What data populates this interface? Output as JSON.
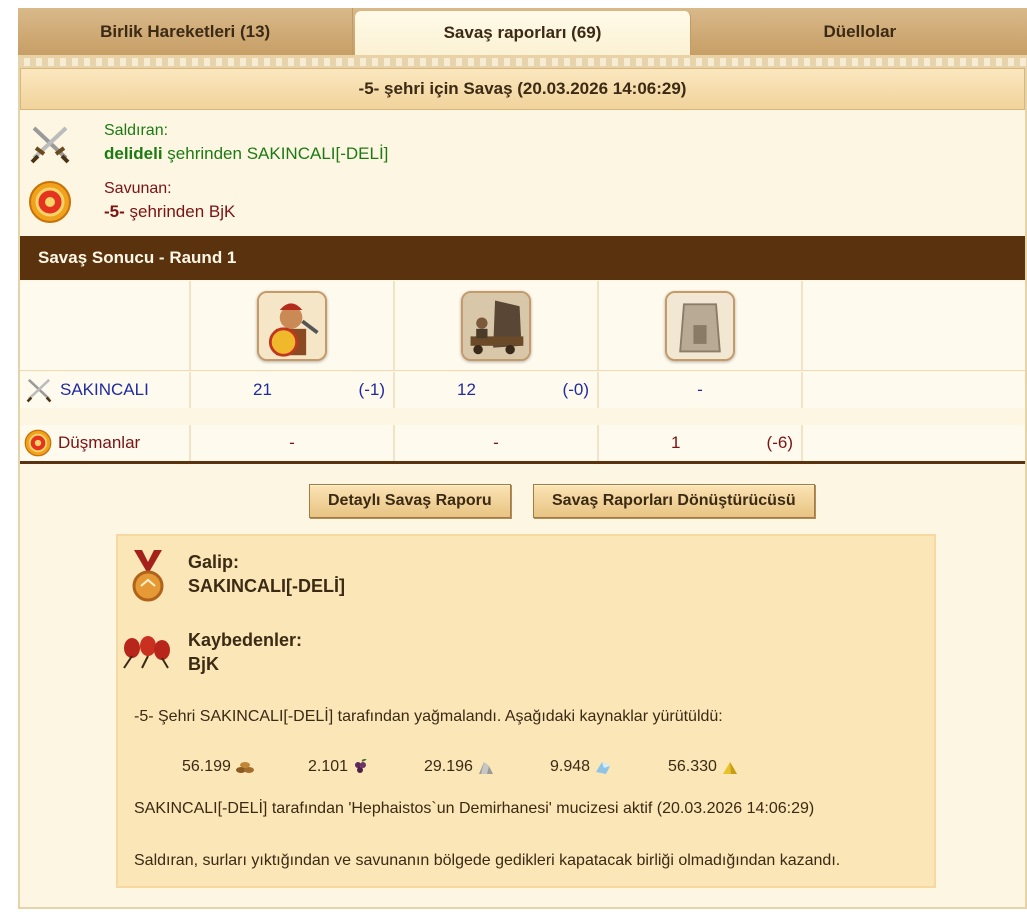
{
  "tabs": [
    {
      "label": "Birlik Hareketleri (13)"
    },
    {
      "label": "Savaş raporları (69)"
    },
    {
      "label": "Düellolar"
    }
  ],
  "report": {
    "title": "-5- şehri için Savaş (20.03.2026 14:06:29)",
    "attacker": {
      "label": "Saldıran:",
      "city": "delideli",
      "rest": " şehrinden SAKINCALI[-DELİ]"
    },
    "defender": {
      "label": "Savunan:",
      "city": "-5-",
      "rest": " şehrinden BjK"
    }
  },
  "result_bar": "Savaş Sonucu - Raund 1",
  "rows": {
    "attacker": {
      "name": "SAKINCALI",
      "u1": "21",
      "u1d": "(-1)",
      "u2": "12",
      "u2d": "(-0)",
      "u3": "-"
    },
    "defender": {
      "name": "Düşmanlar",
      "u1": "-",
      "u2": "-",
      "u3": "1",
      "u3d": "(-6)"
    }
  },
  "buttons": {
    "detailed": "Detaylı Savaş Raporu",
    "converter": "Savaş Raporları Dönüştürücüsü"
  },
  "summary": {
    "winner_label": "Galip:",
    "winner": "SAKINCALI[-DELİ]",
    "loser_label": "Kaybedenler:",
    "loser": "BjK",
    "plunder": "-5- Şehri SAKINCALI[-DELİ] tarafından yağmalandı. Aşağıdaki kaynaklar yürütüldü:",
    "resources": [
      {
        "amount": "56.199",
        "icon": "wood-icon"
      },
      {
        "amount": "2.101",
        "icon": "wine-icon"
      },
      {
        "amount": "29.196",
        "icon": "marble-icon"
      },
      {
        "amount": "9.948",
        "icon": "crystal-icon"
      },
      {
        "amount": "56.330",
        "icon": "sulfur-icon"
      }
    ],
    "wonder": "SAKINCALI[-DELİ] tarafından 'Hephaistos`un Demirhanesi' mucizesi aktif (20.03.2026 14:06:29)",
    "reason": "Saldıran, surları yıktığından ve savunanın bölgede gedikleri kapatacak birliği olmadığından kazandı."
  },
  "colors": {
    "accent": "#5a330e",
    "attacker": "#1d7a13",
    "defender": "#7a1313",
    "link": "#1f2ca1"
  }
}
